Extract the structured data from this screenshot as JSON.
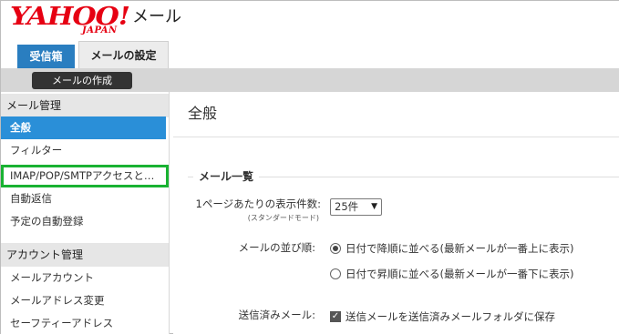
{
  "header": {
    "logo_main": "YAHOO!",
    "logo_sub": "JAPAN",
    "app_title": "メール",
    "brand_color": "#e60012"
  },
  "tabs": [
    {
      "label": "受信箱",
      "active": false
    },
    {
      "label": "メールの設定",
      "active": true
    }
  ],
  "toolbar": {
    "compose_label": "メールの作成"
  },
  "sidebar": {
    "sections": [
      {
        "heading": "メール管理",
        "items": [
          {
            "label": "全般",
            "active": true
          },
          {
            "label": "フィルター"
          },
          {
            "label": "IMAP/POP/SMTPアクセスと…",
            "highlighted": true
          },
          {
            "label": "自動返信"
          },
          {
            "label": "予定の自動登録"
          }
        ]
      },
      {
        "heading": "アカウント管理",
        "items": [
          {
            "label": "メールアカウント"
          },
          {
            "label": "メールアドレス変更"
          },
          {
            "label": "セーフティーアドレス"
          }
        ]
      }
    ],
    "active_color": "#2a8fd8",
    "highlight_color": "#19b232"
  },
  "main": {
    "page_title": "全般",
    "section_title": "メール一覧",
    "per_page": {
      "label": "1ページあたりの表示件数:",
      "sublabel": "(スタンダードモード)",
      "value": "25件"
    },
    "sort_order": {
      "label": "メールの並び順:",
      "options": [
        {
          "label": "日付で降順に並べる(最新メールが一番上に表示)",
          "checked": true
        },
        {
          "label": "日付で昇順に並べる(最新メールが一番下に表示)",
          "checked": false
        }
      ]
    },
    "sent_mail": {
      "label": "送信済みメール:",
      "checkbox_label": "送信メールを送信済みメールフォルダに保存",
      "checked": true
    }
  }
}
